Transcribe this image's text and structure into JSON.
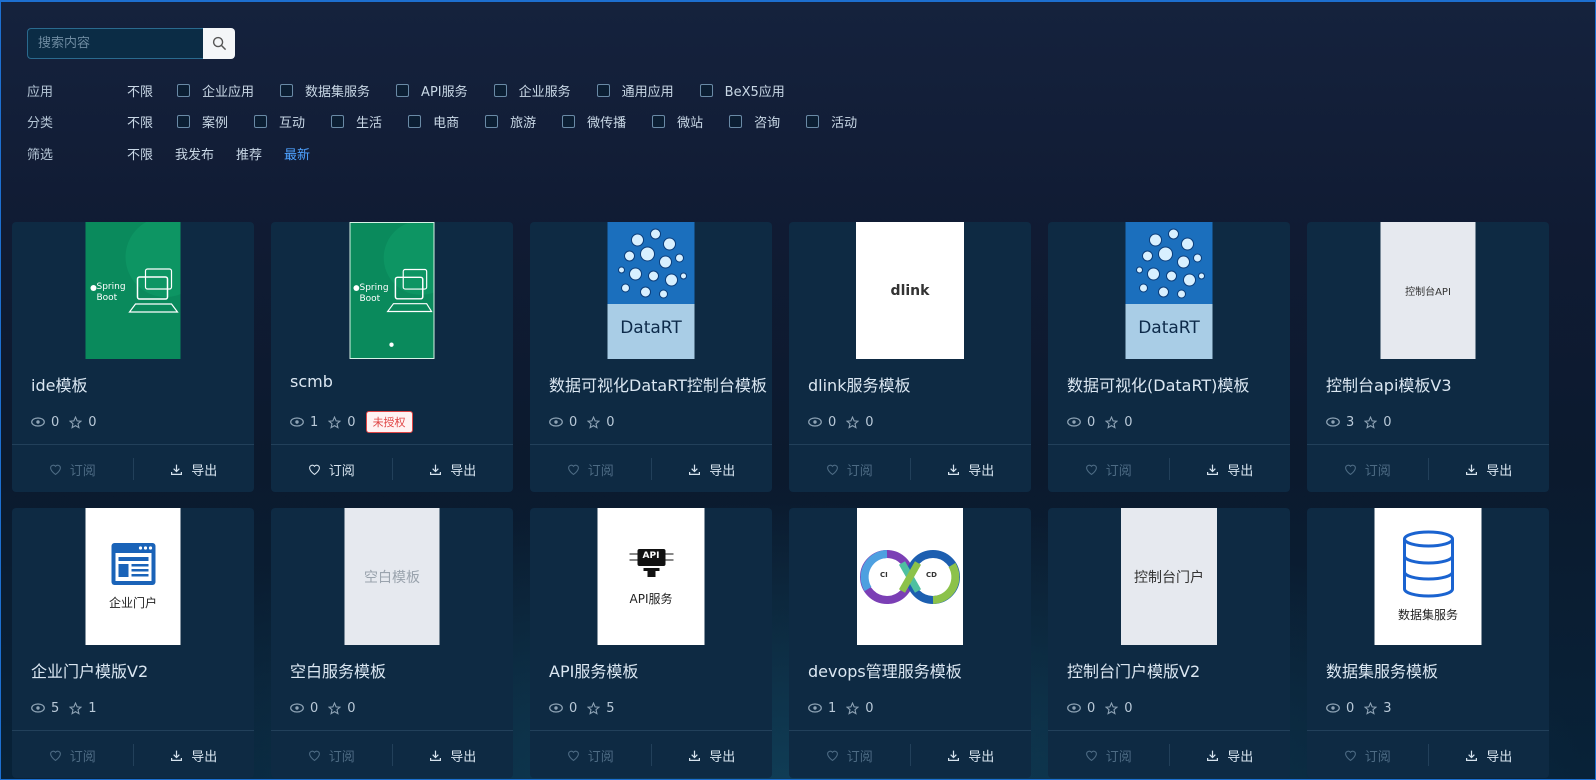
{
  "search": {
    "placeholder": "搜索内容"
  },
  "filters": {
    "app": {
      "label": "应用",
      "any": "不限",
      "options": [
        "企业应用",
        "数据集服务",
        "API服务",
        "企业服务",
        "通用应用",
        "BeX5应用"
      ]
    },
    "category": {
      "label": "分类",
      "any": "不限",
      "options": [
        "案例",
        "互动",
        "生活",
        "电商",
        "旅游",
        "微传播",
        "微站",
        "咨询",
        "活动"
      ]
    },
    "screen": {
      "label": "筛选",
      "any": "不限",
      "links": [
        "我发布",
        "推荐",
        "最新"
      ],
      "active": "最新"
    }
  },
  "actions": {
    "subscribe": "订阅",
    "export": "导出"
  },
  "cards": [
    {
      "title": "ide模板",
      "views": "0",
      "stars": "0",
      "thumb": "spring-boot"
    },
    {
      "title": "scmb",
      "views": "1",
      "stars": "0",
      "badge": "未授权",
      "thumb": "spring-boot-phone"
    },
    {
      "title": "数据可视化DataRT控制台模板",
      "views": "0",
      "stars": "0",
      "thumb": "datart",
      "thumb_text": "DataRT"
    },
    {
      "title": "dlink服务模板",
      "views": "0",
      "stars": "0",
      "thumb": "dlink",
      "thumb_text": "dlink"
    },
    {
      "title": "数据可视化(DataRT)模板",
      "views": "0",
      "stars": "0",
      "thumb": "datart",
      "thumb_text": "DataRT"
    },
    {
      "title": "控制台api模板V3",
      "views": "3",
      "stars": "0",
      "thumb": "console-api",
      "thumb_text": "控制台API"
    },
    {
      "title": "企业门户模版V2",
      "views": "5",
      "stars": "1",
      "thumb": "portal",
      "thumb_text": "企业门户"
    },
    {
      "title": "空白服务模板",
      "views": "0",
      "stars": "0",
      "thumb": "blank",
      "thumb_text": "空白模板"
    },
    {
      "title": "API服务模板",
      "views": "0",
      "stars": "5",
      "thumb": "api",
      "thumb_text": "API服务"
    },
    {
      "title": "devops管理服务模板",
      "views": "1",
      "stars": "0",
      "thumb": "devops"
    },
    {
      "title": "控制台门户模版V2",
      "views": "0",
      "stars": "0",
      "thumb": "console-portal",
      "thumb_text": "控制台门户"
    },
    {
      "title": "数据集服务模板",
      "views": "0",
      "stars": "3",
      "thumb": "dataset",
      "thumb_text": "数据集服务"
    }
  ],
  "spring": {
    "line1": "Spring",
    "line2": "Boot"
  },
  "api_chip": "API",
  "devops": {
    "ci": "CI",
    "cd": "CD"
  },
  "colors": {
    "accent": "#4ea2ff",
    "card_bg": "#0e2a43",
    "badge": "#e04545",
    "spring_green": "#0a8a5c"
  }
}
